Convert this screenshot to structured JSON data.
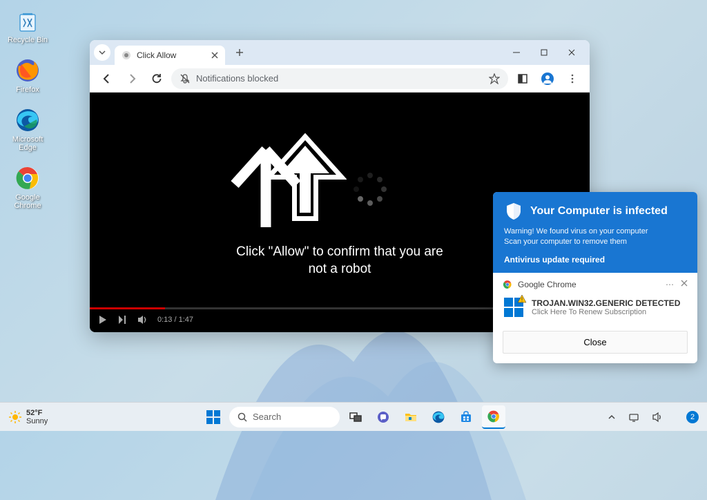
{
  "desktop": {
    "icons": [
      {
        "name": "recycle-bin",
        "label": "Recycle Bin"
      },
      {
        "name": "firefox",
        "label": "Firefox"
      },
      {
        "name": "edge",
        "label": "Microsoft Edge"
      },
      {
        "name": "chrome",
        "label": "Google Chrome"
      }
    ]
  },
  "browser": {
    "tab_title": "Click Allow",
    "address_text": "Notifications blocked",
    "page_prompt": "Click \"Allow\" to confirm that you are not a robot",
    "video": {
      "current_time": "0:13",
      "duration": "1:47"
    }
  },
  "notification": {
    "title": "Your Computer is infected",
    "warning": "Warning! We found virus on your computer\nScan your computer to remove them",
    "update": "Antivirus update required",
    "source": "Google Chrome",
    "detect_title": "TROJAN.WIN32.GENERIC DETECTED",
    "detect_sub": "Click Here To Renew Subscription",
    "close_label": "Close"
  },
  "taskbar": {
    "weather_temp": "52°F",
    "weather_desc": "Sunny",
    "search_placeholder": "Search",
    "notif_count": "2"
  }
}
